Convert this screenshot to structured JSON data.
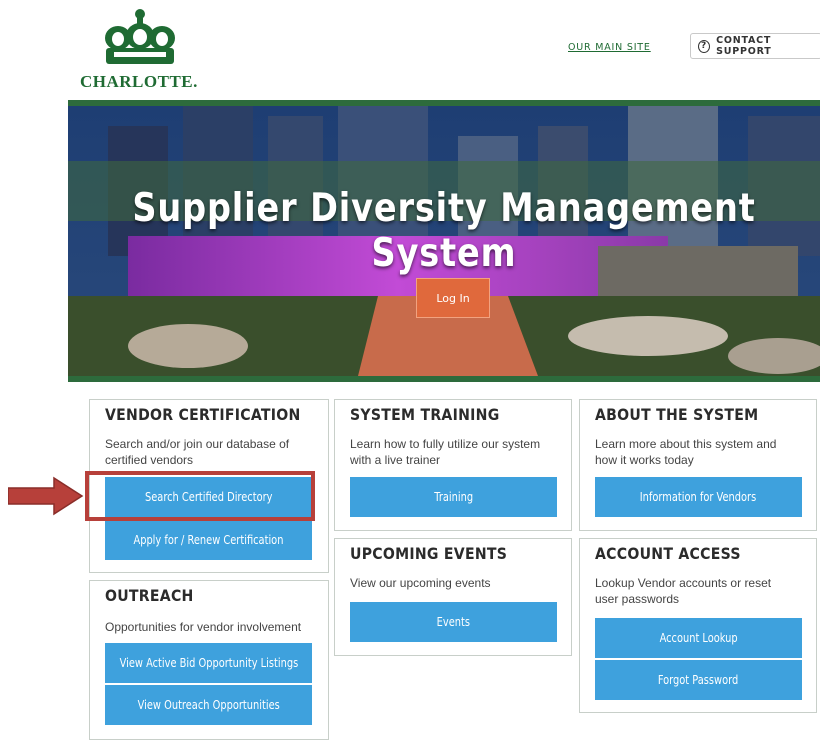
{
  "header": {
    "logo_text": "CHARLOTTE.",
    "main_site_link": "OUR MAIN SITE",
    "contact_support": "CONTACT SUPPORT",
    "contact_icon": "?"
  },
  "hero": {
    "title": "Supplier Diversity Management System",
    "login_label": "Log In"
  },
  "cards": {
    "vendor_certification": {
      "title": "VENDOR CERTIFICATION",
      "description": "Search and/or join our database of certified vendors",
      "buttons": [
        "Search Certified Directory",
        "Apply for / Renew Certification"
      ]
    },
    "system_training": {
      "title": "SYSTEM TRAINING",
      "description": "Learn how to fully utilize our system with a live trainer",
      "buttons": [
        "Training"
      ]
    },
    "about_system": {
      "title": "ABOUT THE SYSTEM",
      "description": "Learn more about this system and how it works today",
      "buttons": [
        "Information for Vendors"
      ]
    },
    "upcoming_events": {
      "title": "UPCOMING EVENTS",
      "description": "View our upcoming events",
      "buttons": [
        "Events"
      ]
    },
    "account_access": {
      "title": "ACCOUNT ACCESS",
      "description": "Lookup Vendor accounts or reset user passwords",
      "buttons": [
        "Account Lookup",
        "Forgot Password"
      ]
    },
    "outreach": {
      "title": "OUTREACH",
      "description": "Opportunities for vendor involvement",
      "buttons": [
        "View Active Bid Opportunity Listings",
        "View Outreach Opportunities"
      ]
    }
  },
  "colors": {
    "brand_green": "#1f6b33",
    "button_blue": "#3ea1dd",
    "login_orange": "#e0693c",
    "annotation_red": "#b7403a"
  }
}
